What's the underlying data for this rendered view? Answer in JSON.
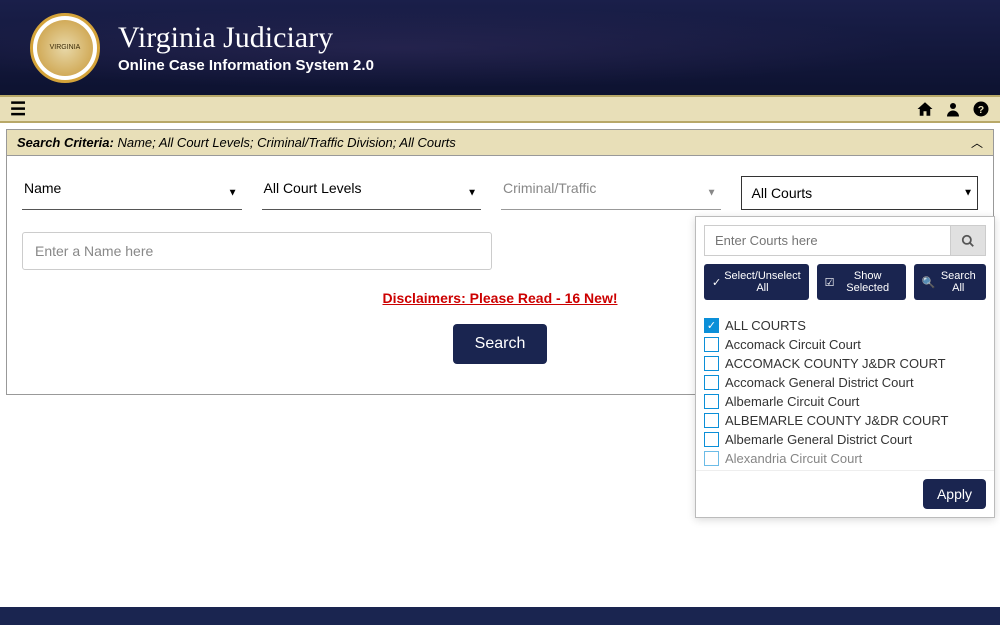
{
  "header": {
    "title": "Virginia Judiciary",
    "subtitle": "Online Case Information System 2.0"
  },
  "criteria": {
    "label": "Search Criteria:",
    "values": "Name; All Court Levels; Criminal/Traffic Division; All Courts"
  },
  "dropdowns": {
    "search_by": "Name",
    "court_level": "All Court Levels",
    "division": "Criminal/Traffic",
    "courts": "All Courts"
  },
  "name_input": {
    "placeholder": "Enter a Name here"
  },
  "disclaimer": {
    "text": "Disclaimers: Please Read - 16 New!"
  },
  "search_button": "Search",
  "courts_panel": {
    "search_placeholder": "Enter Courts here",
    "select_all": "Select/Unselect All",
    "show_selected": "Show Selected",
    "search_all": "Search All",
    "apply": "Apply",
    "items": [
      {
        "label": "ALL COURTS",
        "selected": true
      },
      {
        "label": "Accomack Circuit Court",
        "selected": false
      },
      {
        "label": "ACCOMACK COUNTY J&DR COURT",
        "selected": false
      },
      {
        "label": "Accomack General District Court",
        "selected": false
      },
      {
        "label": "Albemarle Circuit Court",
        "selected": false
      },
      {
        "label": "ALBEMARLE COUNTY J&DR COURT",
        "selected": false
      },
      {
        "label": "Albemarle General District Court",
        "selected": false
      },
      {
        "label": "Alexandria Circuit Court",
        "selected": false
      }
    ]
  }
}
